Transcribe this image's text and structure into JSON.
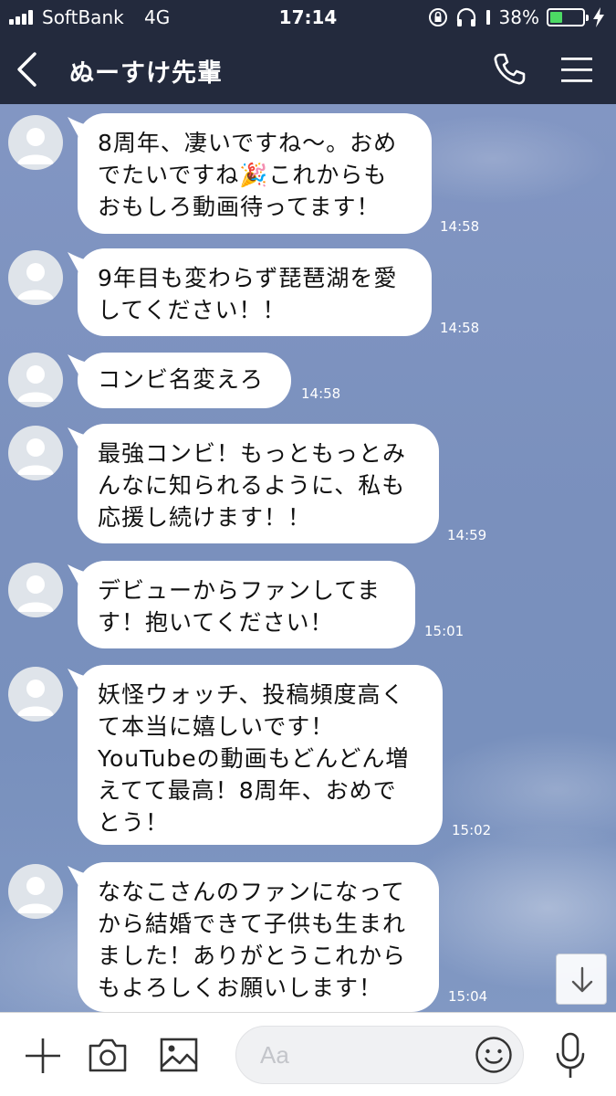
{
  "status_bar": {
    "carrier": "SoftBank",
    "network": "4G",
    "time": "17:14",
    "battery_percent": "38%",
    "battery_level": 0.38
  },
  "header": {
    "title": "ぬーすけ先輩",
    "icons": [
      "back-chevron-icon",
      "phone-icon",
      "hamburger-menu-icon"
    ]
  },
  "messages": [
    {
      "text": "8周年、凄いですね〜。おめ\nでたいですね🎉これからも\nおもしろ動画待ってます！",
      "time": "14:58"
    },
    {
      "text": "9年目も変わらず琵琶湖を愛\nしてください！！",
      "time": "14:58"
    },
    {
      "text": "コンビ名変えろ",
      "time": "14:58"
    },
    {
      "text": "最強コンビ！もっともっとみ\nんなに知られるように、私も\n応援し続けます！！",
      "time": "14:59"
    },
    {
      "text": "デビューからファンしてま\nす！抱いてください！",
      "time": "15:01"
    },
    {
      "text": "妖怪ウォッチ、投稿頻度高く\nて本当に嬉しいです！\nYouTubeの動画もどんどん増\nえてて最高！8周年、おめで\nとう！",
      "time": "15:02"
    },
    {
      "text": "ななこさんのファンになって\nから結婚できて子供も生まれ\nました！ありがとうこれから\nもよろしくお願いします！",
      "time": "15:04"
    }
  ],
  "input_bar": {
    "placeholder": "Aa",
    "icons": [
      "plus-icon",
      "camera-icon",
      "image-icon",
      "emoji-icon",
      "microphone-icon"
    ]
  },
  "colors": {
    "header_bg": "#232a3d",
    "chat_bg": "#7d93bf",
    "bubble_bg": "#ffffff",
    "battery_green": "#4cd964"
  }
}
